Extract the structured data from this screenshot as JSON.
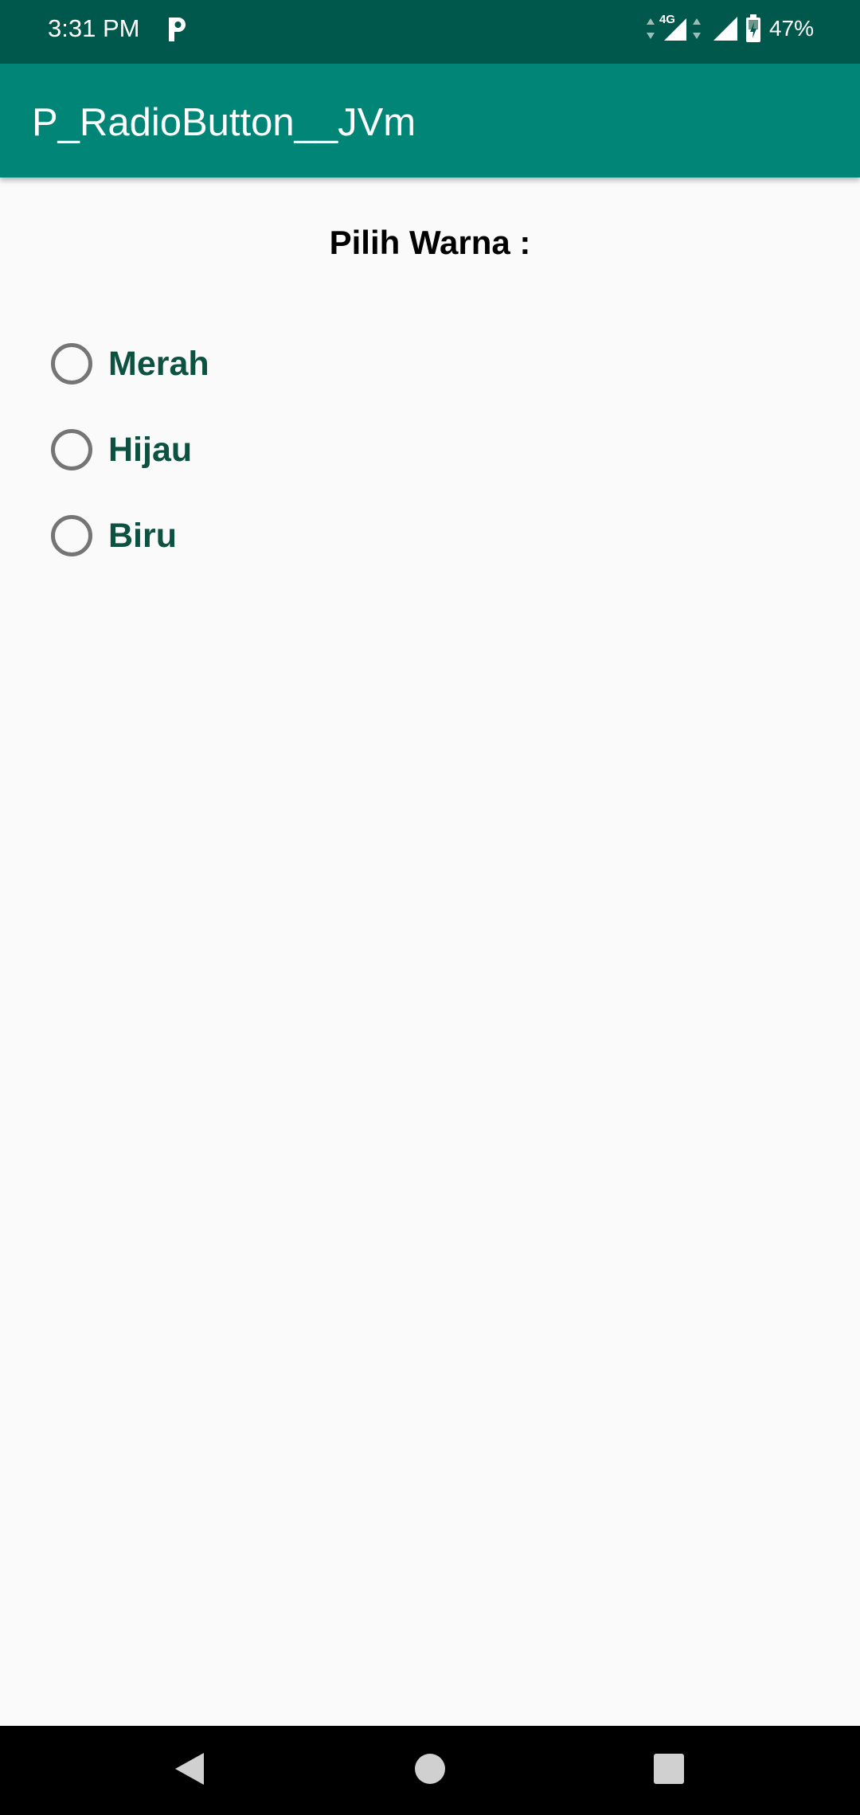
{
  "status_bar": {
    "time": "3:31 PM",
    "network": "4G",
    "battery": "47%",
    "icons": [
      "parking-app-icon",
      "data-arrows-icon",
      "signal-4g-icon",
      "signal-icon",
      "battery-charging-icon"
    ]
  },
  "app_bar": {
    "title": "P_RadioButton__JVm"
  },
  "main": {
    "heading": "Pilih Warna :",
    "options": [
      {
        "label": "Merah",
        "checked": false
      },
      {
        "label": "Hijau",
        "checked": false
      },
      {
        "label": "Biru",
        "checked": false
      }
    ]
  },
  "nav_bar": {
    "buttons": [
      "back-icon",
      "home-icon",
      "recents-icon"
    ]
  },
  "colors": {
    "status_bar": "#00574b",
    "app_bar": "#008577",
    "background": "#fafafa",
    "radio_label": "#0d5240",
    "radio_ring": "#757575"
  }
}
